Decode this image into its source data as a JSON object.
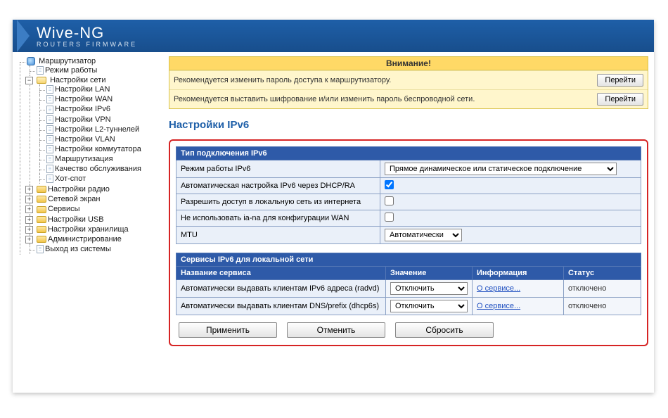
{
  "header": {
    "brand_top": "Wive-NG",
    "brand_sub": "ROUTERS FIRMWARE"
  },
  "sidebar": {
    "root": "Маршрутизатор",
    "mode": "Режим работы",
    "net_settings": "Настройки сети",
    "net_children": [
      "Настройки LAN",
      "Настройки WAN",
      "Настройки IPv6",
      "Настройки VPN",
      "Настройки L2-туннелей",
      "Настройки VLAN",
      "Настройки коммутатора",
      "Маршрутизация",
      "Качество обслуживания",
      "Хот-спот"
    ],
    "radio": "Настройки радио",
    "firewall": "Сетевой экран",
    "services": "Сервисы",
    "usb": "Настройки USB",
    "storage": "Настройки хранилища",
    "admin": "Администрирование",
    "logout": "Выход из системы"
  },
  "alert": {
    "title": "Внимание!",
    "rows": [
      {
        "msg": "Рекомендуется изменить пароль доступа к маршрутизатору.",
        "btn": "Перейти"
      },
      {
        "msg": "Рекомендуется выставить шифрование и/или изменить пароль беспроводной сети.",
        "btn": "Перейти"
      }
    ]
  },
  "page_title": "Настройки IPv6",
  "conn_type": {
    "header": "Тип подключения IPv6",
    "rows": {
      "mode_label": "Режим работы IPv6",
      "mode_value": "Прямое динамическое или статическое подключение",
      "dhcp_label": "Автоматическая настройка IPv6 через DHCP/RA",
      "dhcp_checked": true,
      "inet_label": "Разрешить доступ в локальную сеть из интернета",
      "inet_checked": false,
      "iana_label": "Не использовать ia-na для конфигурации WAN",
      "iana_checked": false,
      "mtu_label": "MTU",
      "mtu_value": "Автоматически"
    }
  },
  "services": {
    "header": "Сервисы IPv6 для локальной сети",
    "cols": {
      "name": "Название сервиса",
      "value": "Значение",
      "info": "Информация",
      "status": "Статус"
    },
    "rows": [
      {
        "name": "Автоматически выдавать клиентам IPv6 адреса (radvd)",
        "value": "Отключить",
        "info": "О сервисе...",
        "status": "отключено"
      },
      {
        "name": "Автоматически выдавать клиентам DNS/prefix (dhcp6s)",
        "value": "Отключить",
        "info": "О сервисе...",
        "status": "отключено"
      }
    ]
  },
  "buttons": {
    "apply": "Применить",
    "cancel": "Отменить",
    "reset": "Сбросить"
  }
}
